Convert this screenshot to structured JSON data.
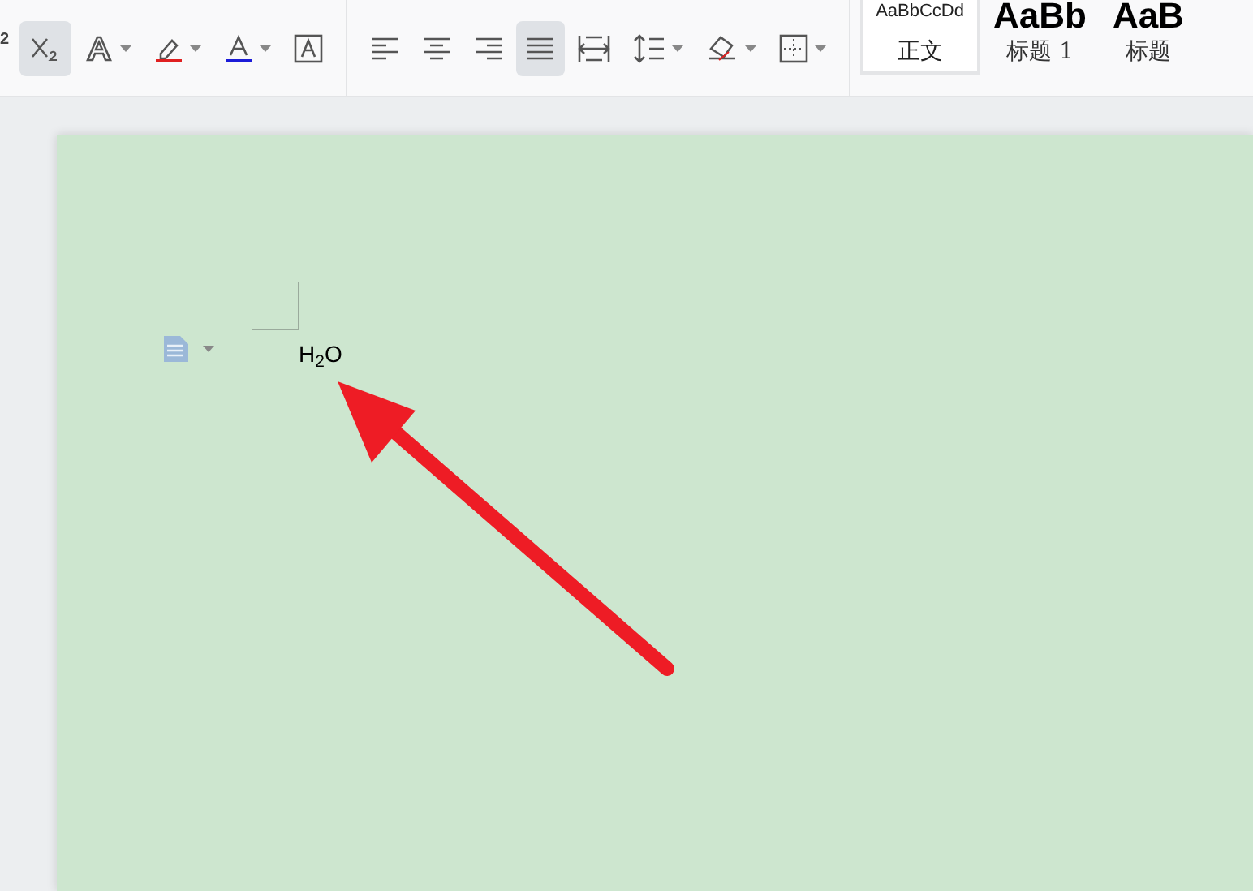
{
  "toolbar": {
    "superscript_fragment": "2",
    "font_buttons": [
      {
        "kind": "subscript",
        "selected": true,
        "dropdown": false
      },
      {
        "kind": "text-effect",
        "selected": false,
        "dropdown": true
      },
      {
        "kind": "highlight",
        "selected": false,
        "dropdown": true
      },
      {
        "kind": "font-color",
        "selected": false,
        "dropdown": true
      },
      {
        "kind": "char-border",
        "selected": false,
        "dropdown": false
      }
    ],
    "paragraph_buttons": [
      {
        "kind": "align-left",
        "selected": false,
        "dropdown": false
      },
      {
        "kind": "align-center",
        "selected": false,
        "dropdown": false
      },
      {
        "kind": "align-right",
        "selected": false,
        "dropdown": false
      },
      {
        "kind": "justify",
        "selected": true,
        "dropdown": false
      },
      {
        "kind": "distribute",
        "selected": false,
        "dropdown": false
      },
      {
        "kind": "line-spacing",
        "selected": false,
        "dropdown": true
      },
      {
        "kind": "shading",
        "selected": false,
        "dropdown": true
      },
      {
        "kind": "borders",
        "selected": false,
        "dropdown": true
      }
    ],
    "styles": [
      {
        "preview": "AaBbCcDd",
        "label": "正文",
        "selected": true,
        "kind": "body"
      },
      {
        "preview": "AaBb",
        "label": "标题 1",
        "selected": false,
        "kind": "heading"
      },
      {
        "preview": "AaB",
        "label": "标题",
        "selected": false,
        "kind": "heading"
      }
    ]
  },
  "document": {
    "text": "H$_{2}$O"
  }
}
